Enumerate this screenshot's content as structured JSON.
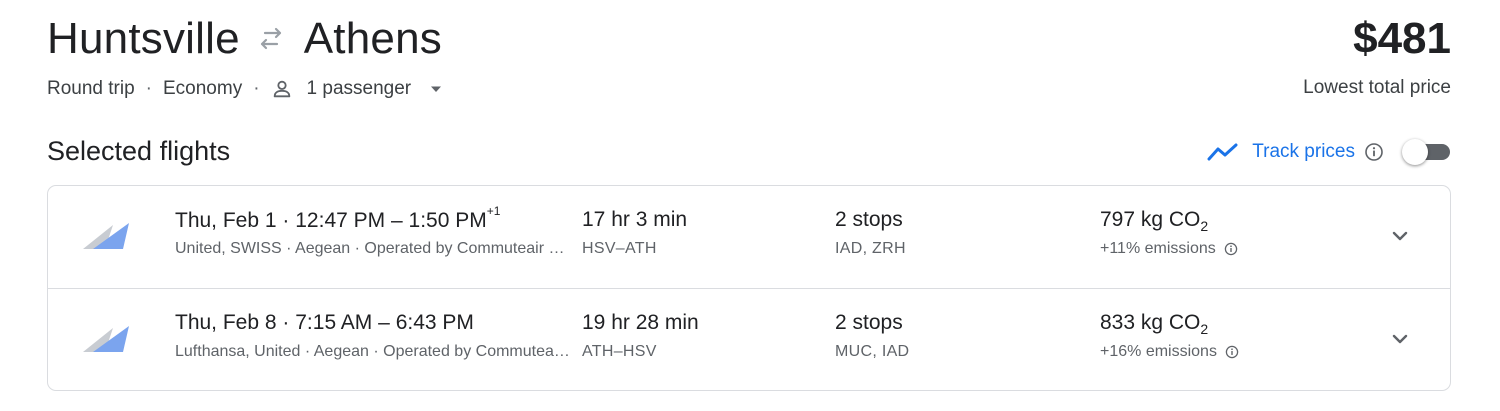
{
  "header": {
    "origin": "Huntsville",
    "destination": "Athens",
    "swap_icon": "swap-arrows-icon",
    "price": "$481",
    "price_label": "Lowest total price"
  },
  "options": {
    "trip_type": "Round trip",
    "separator": "·",
    "cabin": "Economy",
    "passengers": "1 passenger"
  },
  "section": {
    "title": "Selected flights",
    "track_label": "Track prices",
    "track_enabled": false
  },
  "colors": {
    "accent": "#1a73e8",
    "text": "#202124",
    "secondary": "#5f6368",
    "border": "#dadce0"
  },
  "flights": [
    {
      "date": "Thu, Feb 1",
      "dot": "·",
      "depart": "12:47 PM",
      "dash": "–",
      "arrive": "1:50 PM",
      "plus_days": "+1",
      "airlines": "United, SWISS · Aegean · Operated by Commuteair dba United Express",
      "duration": "17 hr 3 min",
      "route": "HSV–ATH",
      "stops": "2 stops",
      "stop_airports": "IAD, ZRH",
      "co2_prefix": "797 kg CO",
      "co2_sub": "2",
      "emissions": "+11% emissions"
    },
    {
      "date": "Thu, Feb 8",
      "dot": "·",
      "depart": "7:15 AM",
      "dash": "–",
      "arrive": "6:43 PM",
      "plus_days": "",
      "airlines": "Lufthansa, United · Aegean · Operated by Commuteair dba United Express",
      "duration": "19 hr 28 min",
      "route": "ATH–HSV",
      "stops": "2 stops",
      "stop_airports": "MUC, IAD",
      "co2_prefix": "833 kg CO",
      "co2_sub": "2",
      "emissions": "+16% emissions"
    }
  ]
}
